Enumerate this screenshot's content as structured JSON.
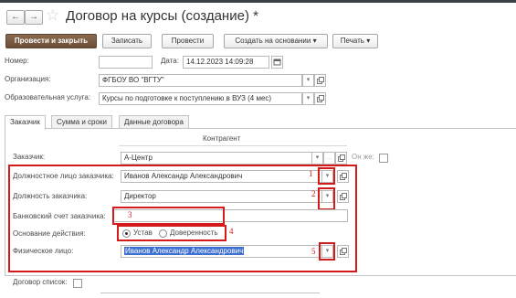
{
  "window": {
    "title": "Договор на курсы (создание) *"
  },
  "nav": {
    "back_glyph": "←",
    "forward_glyph": "→",
    "favorite_glyph": "☆"
  },
  "toolbar": {
    "post_close": "Провести и закрыть",
    "save": "Записать",
    "post": "Провести",
    "create_based": "Создать на основании",
    "print": "Печать",
    "dropdown_glyph": "▾"
  },
  "header": {
    "number_label": "Номер:",
    "number_value": "",
    "date_label": "Дата:",
    "date_value": "14.12.2023 14:09:28",
    "org_label": "Организация:",
    "org_value": "ФГБОУ ВО \"ВГТУ\"",
    "service_label": "Образовательная услуга:",
    "service_value": "Курсы по подготовке к поступлению в ВУЗ (4 мес)"
  },
  "tabs": [
    {
      "label": "Заказчик",
      "active": true
    },
    {
      "label": "Сумма и сроки",
      "active": false
    },
    {
      "label": "Данные договора",
      "active": false
    }
  ],
  "customer_tab": {
    "section_title": "Контрагент",
    "customer_label": "Заказчик:",
    "customer_value": "А-Центр",
    "also_label": "Он же:",
    "official_label": "Должностное лицо заказчика:",
    "official_value": "Иванов Александр Александрович",
    "position_label": "Должность заказчика:",
    "position_value": "Директор",
    "bank_label": "Банковский счет заказчика:",
    "bank_value": "",
    "basis_label": "Основание действия:",
    "basis_options": [
      "Устав",
      "Доверенность"
    ],
    "basis_selected": "Устав",
    "person_label": "Физическое лицо:",
    "person_value": "Иванов Александр Александрович",
    "contract_list_label": "Договор список:"
  },
  "annotations": [
    "1",
    "2",
    "3",
    "4",
    "5"
  ],
  "colors": {
    "accent_primary": "#6b4d36",
    "annotation_red": "#d41a1a",
    "selection_blue": "#3d6fd1"
  },
  "icons": {
    "dropdown": "chevron-down-icon",
    "open": "open-form-icon",
    "calendar": "calendar-icon",
    "clear": "ellipsis-icon"
  }
}
